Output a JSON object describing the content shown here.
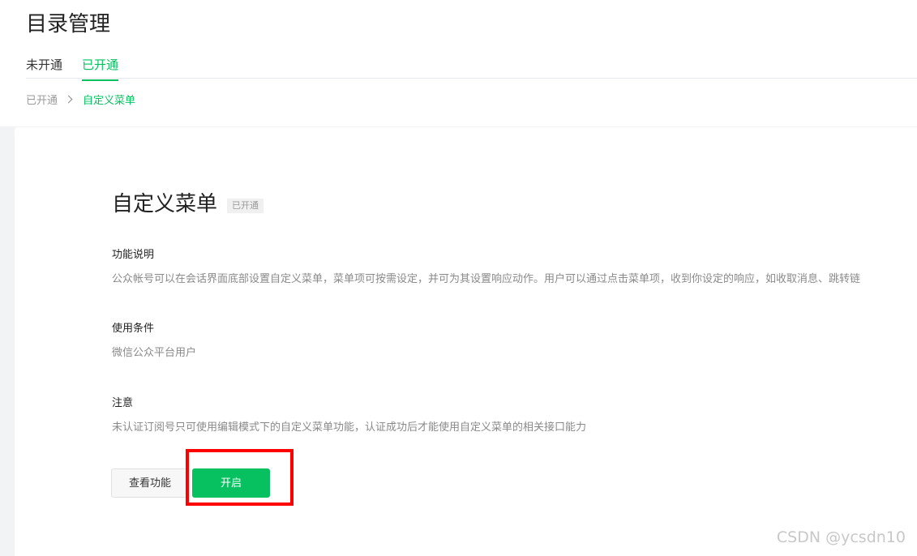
{
  "header": {
    "title": "目录管理",
    "tabs": [
      {
        "label": "未开通",
        "active": false
      },
      {
        "label": "已开通",
        "active": true
      }
    ]
  },
  "breadcrumb": {
    "parent": "已开通",
    "current": "自定义菜单"
  },
  "feature": {
    "title": "自定义菜单",
    "status": "已开通",
    "sections": [
      {
        "heading": "功能说明",
        "body": "公众帐号可以在会话界面底部设置自定义菜单，菜单项可按需设定，并可为其设置响应动作。用户可以通过点击菜单项，收到你设定的响应，如收取消息、跳转链"
      },
      {
        "heading": "使用条件",
        "body": "微信公众平台用户"
      },
      {
        "heading": "注意",
        "body": "未认证订阅号只可使用编辑模式下的自定义菜单功能，认证成功后才能使用自定义菜单的相关接口能力"
      }
    ],
    "buttons": {
      "view_label": "查看功能",
      "enable_label": "开启"
    }
  },
  "watermark": "CSDN @ycsdn10",
  "colors": {
    "accent": "#07c160",
    "highlight": "#ff0000"
  }
}
